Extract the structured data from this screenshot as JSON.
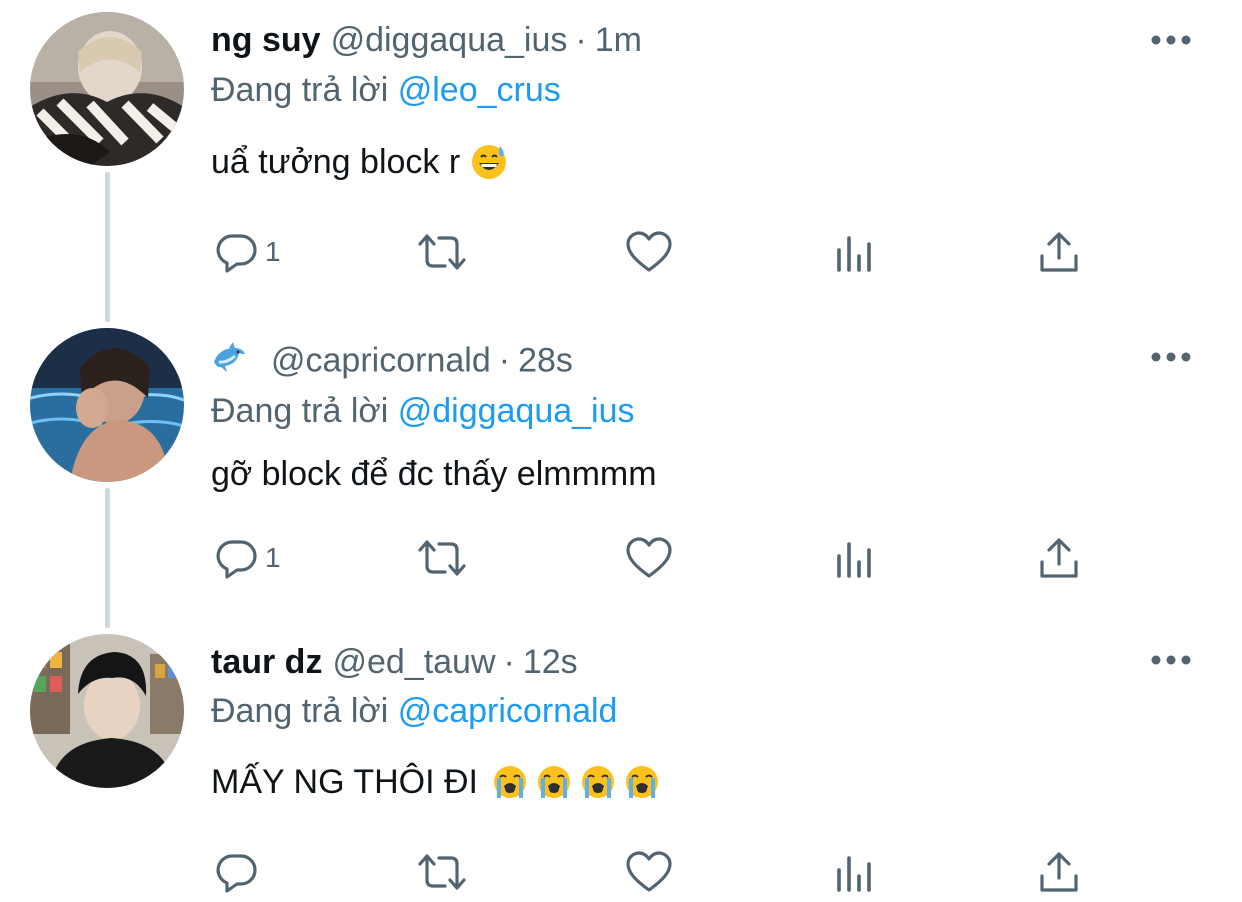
{
  "tweets": [
    {
      "name": "ng suy",
      "handle": "@diggaqua_ius",
      "time": "1m",
      "replying_prefix": "Đang trả lời",
      "replying_to": "@leo_crus",
      "text": "uẩ tưởng block r",
      "emojis": [
        "grinning-sweat"
      ],
      "reply_count": "1"
    },
    {
      "name": "",
      "name_icon": "dolphin-icon",
      "handle": "@capricornald",
      "time": "28s",
      "replying_prefix": "Đang trả lời",
      "replying_to": "@diggaqua_ius",
      "text": "gỡ block để đc thấy elmmmm",
      "emojis": [],
      "reply_count": "1"
    },
    {
      "name": "taur dz",
      "handle": "@ed_tauw",
      "time": "12s",
      "replying_prefix": "Đang trả lời",
      "replying_to": "@capricornald",
      "text": "MẤY NG THÔI ĐI",
      "emojis": [
        "loudly-crying",
        "loudly-crying",
        "loudly-crying",
        "loudly-crying"
      ],
      "reply_count": ""
    }
  ],
  "separator": "·",
  "colors": {
    "link": "#1d9bf0",
    "secondary": "#536471",
    "text": "#0f1419",
    "thread_line": "#cfd9de"
  }
}
